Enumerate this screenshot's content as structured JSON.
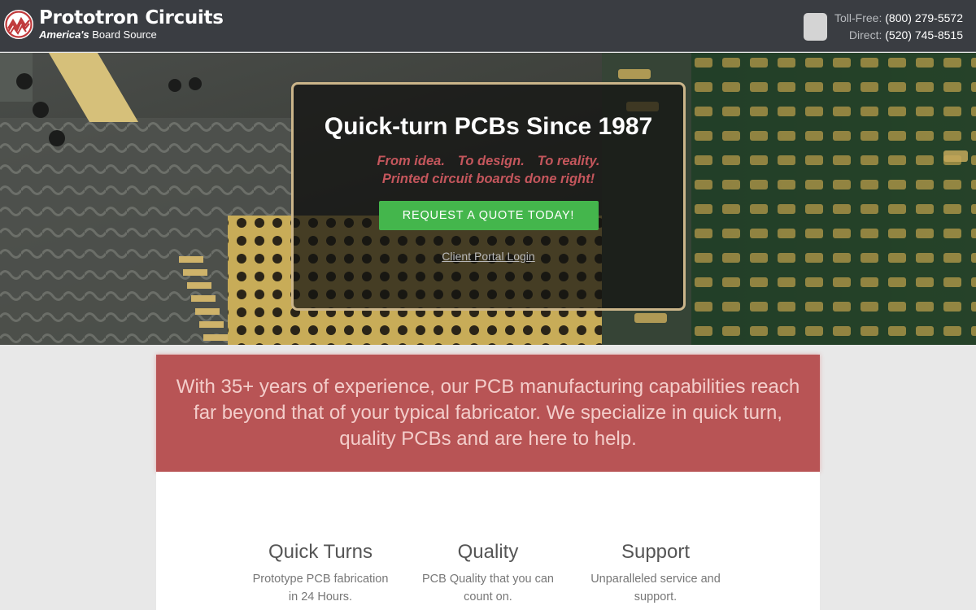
{
  "header": {
    "logo_title": "Prototron Circuits",
    "logo_tagline_bold": "America's",
    "logo_tagline_rest": " Board Source",
    "toll_free_label": "Toll-Free:",
    "toll_free_number": "(800) 279-5572",
    "direct_label": "Direct:",
    "direct_number": "(520) 745-8515",
    "menu_icon": "menu-icon"
  },
  "hero": {
    "title": "Quick-turn PCBs Since 1987",
    "sub_line1": [
      "From idea.",
      "To design.",
      "To reality."
    ],
    "sub_line2": "Printed circuit boards done right!",
    "quote_button": "REQUEST A QUOTE TODAY!",
    "portal_link": "Client Portal Login"
  },
  "banner": {
    "text": "With 35+ years of experience, our PCB manufacturing capabilities reach far beyond that of your typical fabricator. We specialize in quick turn, quality PCBs and are here to help."
  },
  "features": [
    {
      "title": "Quick Turns",
      "text": "Prototype PCB fabrication in 24 Hours."
    },
    {
      "title": "Quality",
      "text": "PCB Quality that you can count on."
    },
    {
      "title": "Support",
      "text": "Unparalleled service and support."
    }
  ],
  "colors": {
    "header_bg": "#3a3d42",
    "accent_red": "#b85455",
    "quote_green": "#44b64c",
    "hero_tagline": "#c4565c",
    "card_border": "#cbb58a"
  }
}
